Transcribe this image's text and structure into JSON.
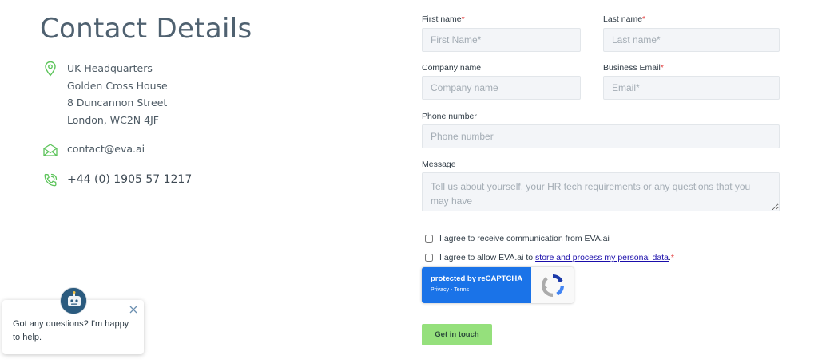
{
  "contact": {
    "title": "Contact Details",
    "address": [
      "UK Headquarters",
      "Golden Cross House",
      "8 Duncannon Street",
      "London, WC2N 4JF"
    ],
    "email": "contact@eva.ai",
    "phone": "+44 (0) 1905 57 1217",
    "icon_color": "#5cc45a"
  },
  "form": {
    "first_name": {
      "label": "First name",
      "required_mark": "*",
      "placeholder": "First Name*"
    },
    "last_name": {
      "label": "Last name",
      "required_mark": "*",
      "placeholder": "Last name*"
    },
    "company": {
      "label": "Company name",
      "placeholder": "Company name"
    },
    "email": {
      "label": "Business Email",
      "required_mark": "*",
      "placeholder": "Email*"
    },
    "phone": {
      "label": "Phone number",
      "placeholder": "Phone number"
    },
    "message": {
      "label": "Message",
      "placeholder": "Tell us about yourself, your HR tech requirements or any questions that you may have"
    },
    "consent_comm": "I agree to receive communication from EVA.ai",
    "consent_data_prefix": "I agree to allow EVA.ai to",
    "consent_data_link": "store and process my personal data",
    "consent_data_suffix": ".",
    "consent_data_required": "*",
    "recaptcha": {
      "protected": "protected by reCAPTCHA",
      "privacy": "Privacy",
      "sep": " - ",
      "terms": "Terms"
    },
    "submit_label": "Get in touch",
    "submit_color": "#95e07c"
  },
  "chat": {
    "message": "Got any questions? I'm happy to help."
  }
}
